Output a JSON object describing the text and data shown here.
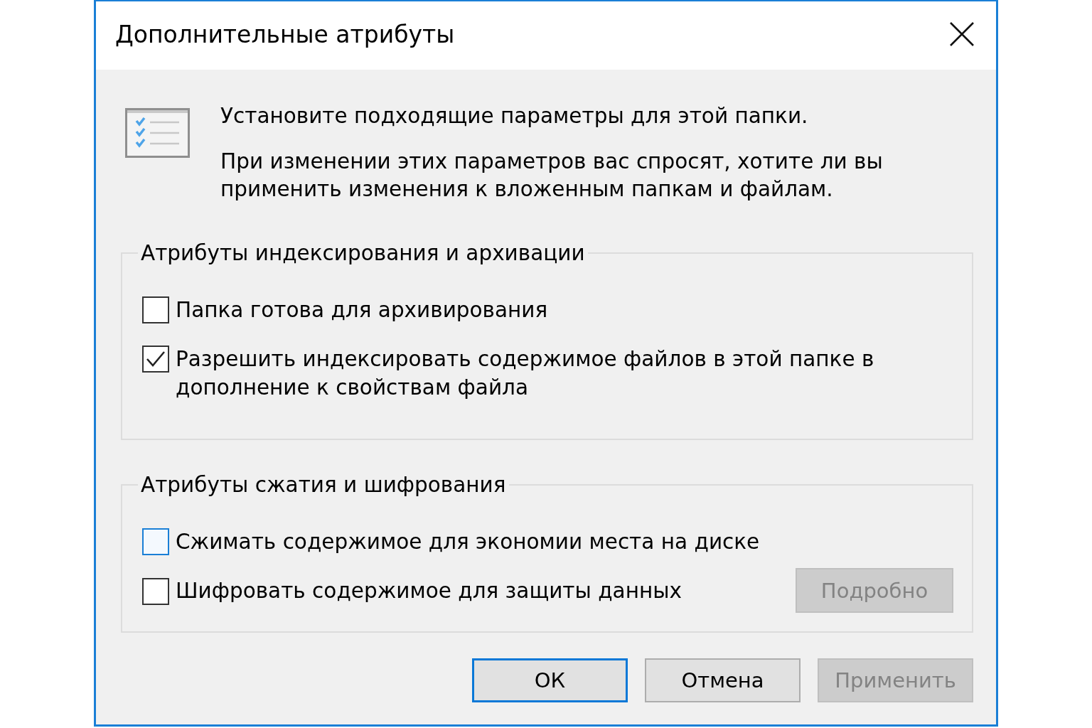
{
  "window": {
    "title": "Дополнительные атрибуты"
  },
  "intro": {
    "heading": "Установите подходящие параметры для этой папки.",
    "note": "При изменении этих параметров вас спросят, хотите ли вы применить изменения к вложенным папкам и файлам."
  },
  "groups": [
    {
      "title": "Атрибуты индексирования и архивации",
      "options": [
        {
          "label": "Папка готова для архивирования",
          "checked": false,
          "focused": false
        },
        {
          "label": "Разрешить индексировать содержимое файлов в этой папке в дополнение к свойствам файла",
          "checked": true,
          "focused": false
        }
      ]
    },
    {
      "title": "Атрибуты сжатия и шифрования",
      "options": [
        {
          "label": "Сжимать содержимое для экономии места на диске",
          "checked": false,
          "focused": true
        },
        {
          "label": "Шифровать содержимое для защиты данных",
          "checked": false,
          "focused": false,
          "button": {
            "label": "Подробно",
            "disabled": true
          }
        }
      ]
    }
  ],
  "buttons": [
    {
      "label": "ОК",
      "default": true,
      "disabled": false
    },
    {
      "label": "Отмена",
      "default": false,
      "disabled": false
    },
    {
      "label": "Применить",
      "default": false,
      "disabled": true
    }
  ]
}
